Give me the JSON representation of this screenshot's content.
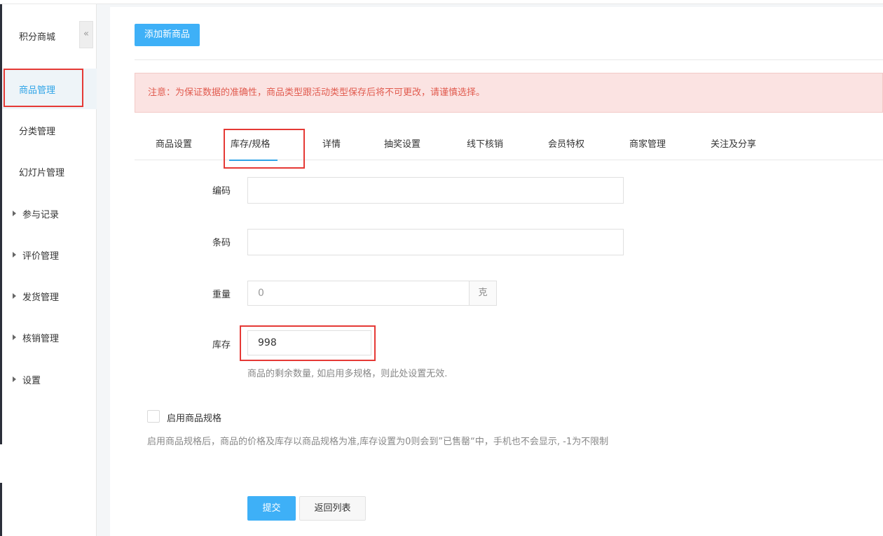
{
  "sidebar": {
    "title": "积分商城",
    "collapse_icon": "«",
    "items": [
      {
        "label": "商品管理"
      },
      {
        "label": "分类管理"
      },
      {
        "label": "幻灯片管理"
      },
      {
        "label": "参与记录"
      },
      {
        "label": "评价管理"
      },
      {
        "label": "发货管理"
      },
      {
        "label": "核销管理"
      },
      {
        "label": "设置"
      }
    ]
  },
  "main": {
    "add_button": "添加新商品",
    "alert": "注意：为保证数据的准确性，商品类型跟活动类型保存后将不可更改，请谨慎选择。",
    "tabs": [
      {
        "label": "商品设置"
      },
      {
        "label": "库存/规格"
      },
      {
        "label": "详情"
      },
      {
        "label": "抽奖设置"
      },
      {
        "label": "线下核销"
      },
      {
        "label": "会员特权"
      },
      {
        "label": "商家管理"
      },
      {
        "label": "关注及分享"
      }
    ],
    "form": {
      "code_label": "编码",
      "code_value": "",
      "barcode_label": "条码",
      "barcode_value": "",
      "weight_label": "重量",
      "weight_placeholder": "0",
      "weight_unit": "克",
      "stock_label": "库存",
      "stock_value": "998",
      "stock_help": "商品的剩余数量, 如启用多规格，则此处设置无效.",
      "spec_checkbox_label": "启用商品规格",
      "spec_help": "启用商品规格后，商品的价格及库存以商品规格为准,库存设置为0则会到”已售罄“中，手机也不会显示, -1为不限制"
    },
    "submit_label": "提交",
    "back_label": "返回列表"
  },
  "colors": {
    "accent": "#3eb0f7",
    "highlight": "#e53935",
    "alert_bg": "#fbe3e2",
    "alert_text": "#e15b4f"
  }
}
